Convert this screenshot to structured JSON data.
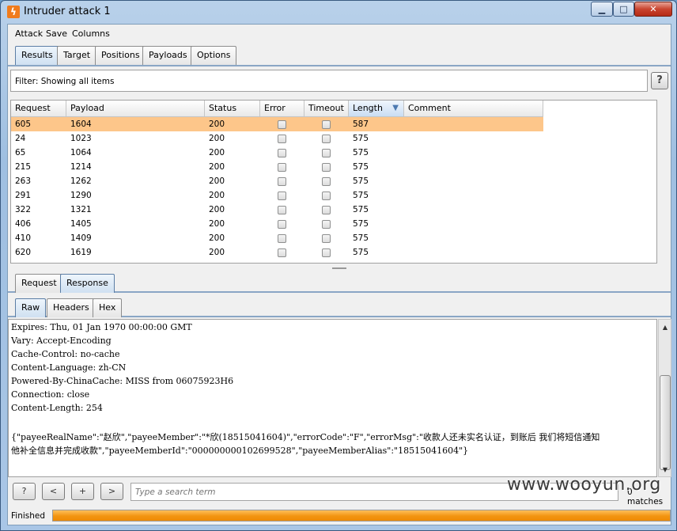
{
  "window": {
    "title": "Intruder attack 1",
    "icon": "burp-lightning-icon"
  },
  "menu": [
    "Attack",
    "Save",
    "Columns"
  ],
  "tabs": [
    {
      "label": "Results",
      "active": true
    },
    {
      "label": "Target",
      "active": false
    },
    {
      "label": "Positions",
      "active": false
    },
    {
      "label": "Payloads",
      "active": false
    },
    {
      "label": "Options",
      "active": false
    }
  ],
  "filter": {
    "label": "Filter:",
    "value": "Showing all items",
    "help": "?"
  },
  "table": {
    "columns": [
      "Request",
      "Payload",
      "Status",
      "Error",
      "Timeout",
      "Length",
      "Comment"
    ],
    "sorted_column": "Length",
    "rows": [
      {
        "request": "605",
        "payload": "1604",
        "status": "200",
        "error": false,
        "timeout": false,
        "length": "587",
        "comment": "",
        "selected": true
      },
      {
        "request": "24",
        "payload": "1023",
        "status": "200",
        "error": false,
        "timeout": false,
        "length": "575",
        "comment": ""
      },
      {
        "request": "65",
        "payload": "1064",
        "status": "200",
        "error": false,
        "timeout": false,
        "length": "575",
        "comment": ""
      },
      {
        "request": "215",
        "payload": "1214",
        "status": "200",
        "error": false,
        "timeout": false,
        "length": "575",
        "comment": ""
      },
      {
        "request": "263",
        "payload": "1262",
        "status": "200",
        "error": false,
        "timeout": false,
        "length": "575",
        "comment": ""
      },
      {
        "request": "291",
        "payload": "1290",
        "status": "200",
        "error": false,
        "timeout": false,
        "length": "575",
        "comment": ""
      },
      {
        "request": "322",
        "payload": "1321",
        "status": "200",
        "error": false,
        "timeout": false,
        "length": "575",
        "comment": ""
      },
      {
        "request": "406",
        "payload": "1405",
        "status": "200",
        "error": false,
        "timeout": false,
        "length": "575",
        "comment": ""
      },
      {
        "request": "410",
        "payload": "1409",
        "status": "200",
        "error": false,
        "timeout": false,
        "length": "575",
        "comment": ""
      },
      {
        "request": "620",
        "payload": "1619",
        "status": "200",
        "error": false,
        "timeout": false,
        "length": "575",
        "comment": ""
      }
    ]
  },
  "msg_tabs": [
    {
      "label": "Request",
      "active": false
    },
    {
      "label": "Response",
      "active": true
    }
  ],
  "view_tabs": [
    {
      "label": "Raw",
      "active": true
    },
    {
      "label": "Headers",
      "active": false
    },
    {
      "label": "Hex",
      "active": false
    }
  ],
  "response_lines": [
    "Expires: Thu, 01 Jan 1970 00:00:00 GMT",
    "Vary: Accept-Encoding",
    "Cache-Control: no-cache",
    "Content-Language: zh-CN",
    "Powered-By-ChinaCache: MISS from 06075923H6",
    "Connection: close",
    "Content-Length: 254",
    "",
    "{\"payeeRealName\":\"赵欣\",\"payeeMember\":\"*欣(18515041604)\",\"errorCode\":\"F\",\"errorMsg\":\"收款人还未实名认证，到账后        我们将短信通知",
    "他补全信息并完成收款\",\"payeeMemberId\":\"000000000102699528\",\"payeeMemberAlias\":\"18515041604\"}"
  ],
  "search": {
    "help": "?",
    "prev": "<",
    "add": "+",
    "next": ">",
    "placeholder": "Type a search term",
    "matches": "0 matches"
  },
  "status": {
    "text": "Finished",
    "progress_fraction": 1.0
  },
  "watermark": "www.wooyun.org"
}
